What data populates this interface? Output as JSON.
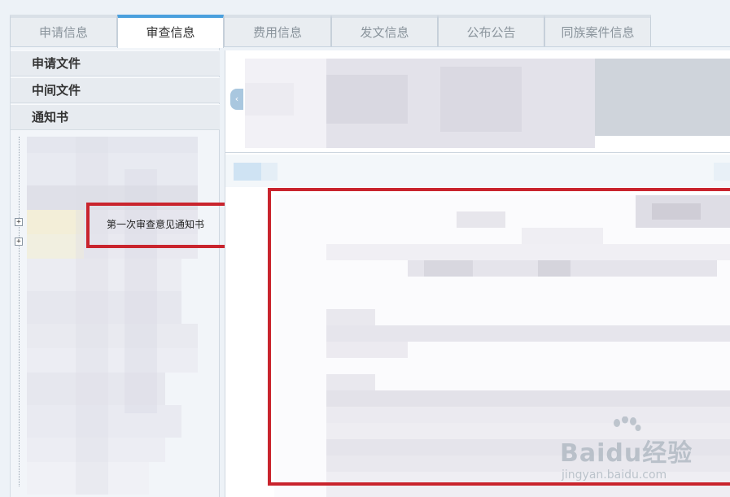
{
  "tabs": [
    {
      "label": "申请信息",
      "active": false
    },
    {
      "label": "审查信息",
      "active": true
    },
    {
      "label": "费用信息",
      "active": false
    },
    {
      "label": "发文信息",
      "active": false
    },
    {
      "label": "公布公告",
      "active": false
    },
    {
      "label": "同族案件信息",
      "active": false
    }
  ],
  "sidebar": {
    "sections": [
      "申请文件",
      "中间文件",
      "通知书"
    ],
    "tree_toggle": "+",
    "highlighted_item": "第一次审查意见通知书"
  },
  "main": {
    "collapse_icon": "‹"
  },
  "watermark": {
    "brand": "Baidu经验",
    "url": "jingyan.baidu.com"
  },
  "colors": {
    "active_tab_accent": "#4aa0dd",
    "highlight_border": "#c9242d"
  }
}
